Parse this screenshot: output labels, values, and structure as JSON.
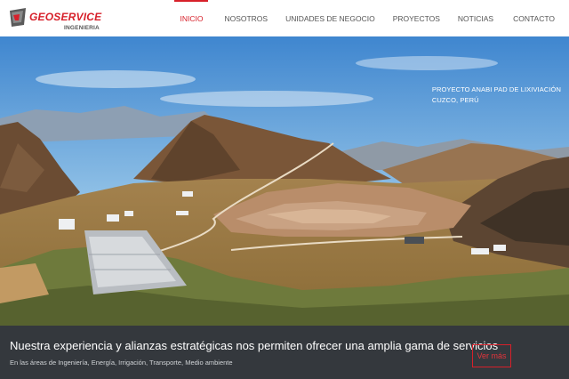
{
  "brand": {
    "name": "GEOSERVICE",
    "subtitle": "INGENIERIA",
    "accent_color": "#d7202a",
    "logo_icon": "geoservice-logo-mark"
  },
  "nav": {
    "items": [
      {
        "label": "INICIO",
        "active": true
      },
      {
        "label": "NOSOTROS",
        "active": false
      },
      {
        "label": "UNIDADES DE NEGOCIO",
        "active": false
      },
      {
        "label": "PROYECTOS",
        "active": false
      },
      {
        "label": "NOTICIAS",
        "active": false
      },
      {
        "label": "CONTACTO",
        "active": false
      }
    ]
  },
  "hero": {
    "caption_line1": "PROYECTO ANABI PAD DE LIXIVIACIÓN",
    "caption_line2": "CUZCO, PERÚ",
    "image": "mining-leach-pad-landscape"
  },
  "banner": {
    "title": "Nuestra experiencia y alianzas estratégicas nos permiten ofrecer una amplia gama de servicios",
    "subtitle": "En las áreas de Ingeniería, Energía, Irrigación, Transporte, Medio ambiente",
    "button_label": "Ver más",
    "background": "#34383d"
  }
}
